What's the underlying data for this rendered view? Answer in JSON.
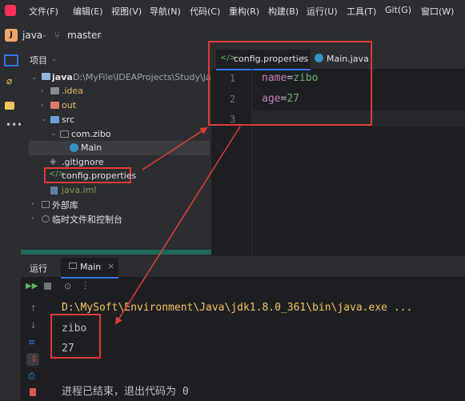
{
  "menu": [
    "文件(F)",
    "编辑(E)",
    "视图(V)",
    "导航(N)",
    "代码(C)",
    "重构(R)",
    "构建(B)",
    "运行(U)",
    "工具(T)",
    "Git(G)",
    "窗口(W)"
  ],
  "toolbar": {
    "project_badge": "J",
    "project_name": "java",
    "branch": "master"
  },
  "project_panel": {
    "title": "项目",
    "root_label": "java",
    "root_path": "D:\\MyFile\\IDEAProjects\\Study\\java",
    "idea": ".idea",
    "out": "out",
    "src": "src",
    "package": "com.zibo",
    "main_class": "Main",
    "gitignore": ".gitignore",
    "config_file": "config.properties",
    "iml": "java.iml",
    "external_libs": "外部库",
    "scratches": "临时文件和控制台"
  },
  "editor": {
    "tabs": [
      "config.properties",
      "Main.java"
    ],
    "lines": [
      {
        "num": "1",
        "key": "name",
        "eq": "=",
        "val": "zibo"
      },
      {
        "num": "2",
        "key": "age",
        "eq": "=",
        "val": "27"
      },
      {
        "num": "3",
        "key": "",
        "eq": "",
        "val": ""
      }
    ]
  },
  "run": {
    "title": "运行",
    "tab": "Main",
    "command": "D:\\MySoft\\Environment\\Java\\jdk1.8.0_361\\bin\\java.exe ...",
    "output": [
      "zibo",
      "27"
    ],
    "exit_message": "进程已结束，退出代码为 0"
  },
  "colors": {
    "accent": "#3574f0",
    "annotation": "#e03a3a",
    "key": "#c77dbb",
    "value": "#6aab73",
    "command": "#f2c55c"
  }
}
